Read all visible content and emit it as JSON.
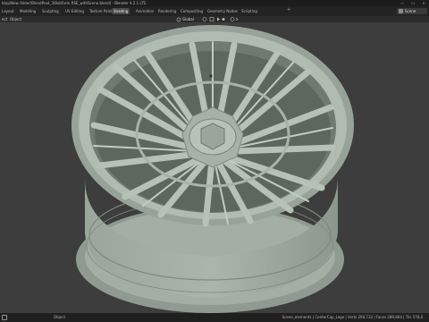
{
  "window": {
    "title": "ktop\\New folder\\BlendProd_3\\Rotiform RSE_withScene.blend] - Blender 4.2.1 LTS",
    "controls": [
      "—",
      "☐",
      "✕"
    ]
  },
  "workspace_tabs": [
    {
      "label": "Layout",
      "active": false
    },
    {
      "label": "Modeling",
      "active": false
    },
    {
      "label": "Sculpting",
      "active": false
    },
    {
      "label": "UV Editing",
      "active": false
    },
    {
      "label": "Texture Paint",
      "active": false
    },
    {
      "label": "Shading",
      "active": true
    },
    {
      "label": "Animation",
      "active": false
    },
    {
      "label": "Rendering",
      "active": false
    },
    {
      "label": "Compositing",
      "active": false
    },
    {
      "label": "Geometry Nodes",
      "active": false
    },
    {
      "label": "Scripting",
      "active": false
    }
  ],
  "add_workspace": "+",
  "scene": {
    "label": "Scene"
  },
  "viewport_header": {
    "mode": "ect",
    "object_menu": "Object",
    "orientation": "Global"
  },
  "statusbar": {
    "left": "Object",
    "stats": "Scene_elements | CenterCap_Logo | Verts 290,733 | Faces 289,804 | Tris 578,0..."
  },
  "colors": {
    "viewport_bg": "#3d3d3d",
    "wheel": "#a9b5aa",
    "wheel_shadow": "#6f7a70",
    "accent": "#4a4a4a"
  }
}
